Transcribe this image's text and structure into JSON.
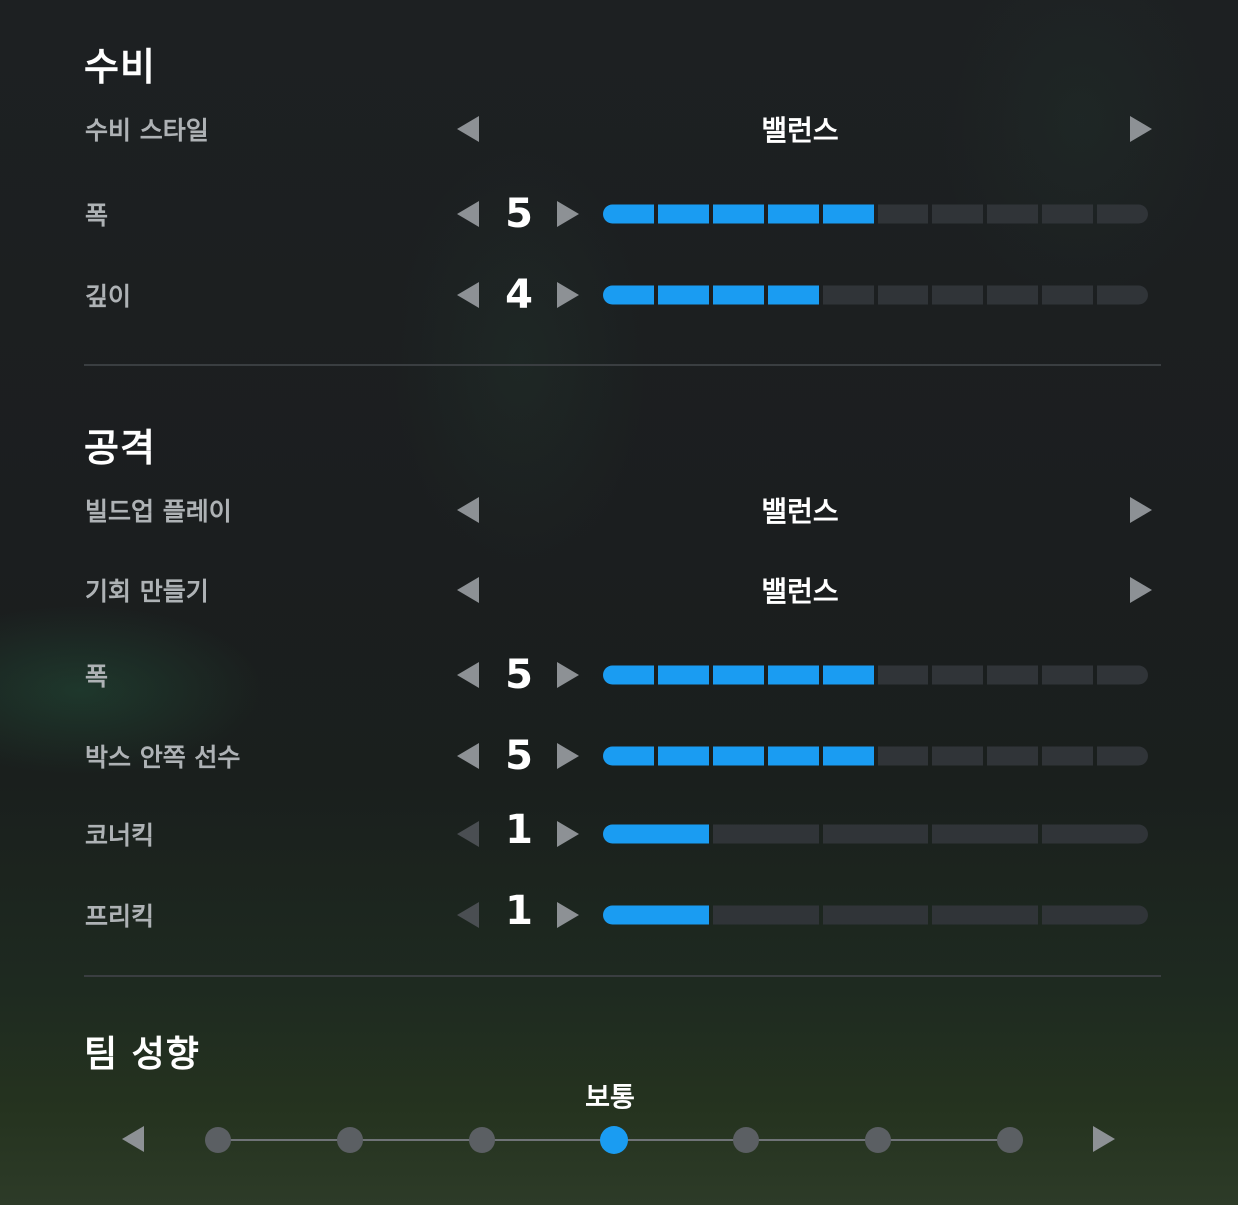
{
  "defense": {
    "title": "수비",
    "style": {
      "label": "수비 스타일",
      "value": "밸런스"
    },
    "width": {
      "label": "폭",
      "value": "5",
      "level": 5,
      "max": 10
    },
    "depth": {
      "label": "깊이",
      "value": "4",
      "level": 4,
      "max": 10
    }
  },
  "attack": {
    "title": "공격",
    "buildup": {
      "label": "빌드업 플레이",
      "value": "밸런스"
    },
    "chance_creation": {
      "label": "기회 만들기",
      "value": "밸런스"
    },
    "width": {
      "label": "폭",
      "value": "5",
      "level": 5,
      "max": 10
    },
    "players_in_box": {
      "label": "박스 안쪽 선수",
      "value": "5",
      "level": 5,
      "max": 10
    },
    "corners": {
      "label": "코너킥",
      "value": "1",
      "level": 1,
      "max": 5
    },
    "free_kicks": {
      "label": "프리킥",
      "value": "1",
      "level": 1,
      "max": 5
    }
  },
  "team_mentality": {
    "title": "팀 성향",
    "value": "보통",
    "position": 4,
    "steps": 7
  },
  "colors": {
    "accent": "#1a9cf2",
    "inactive": "#303438",
    "label": "#aeb2b5"
  },
  "icons": {
    "prev": "triangle-left-icon",
    "next": "triangle-right-icon"
  }
}
